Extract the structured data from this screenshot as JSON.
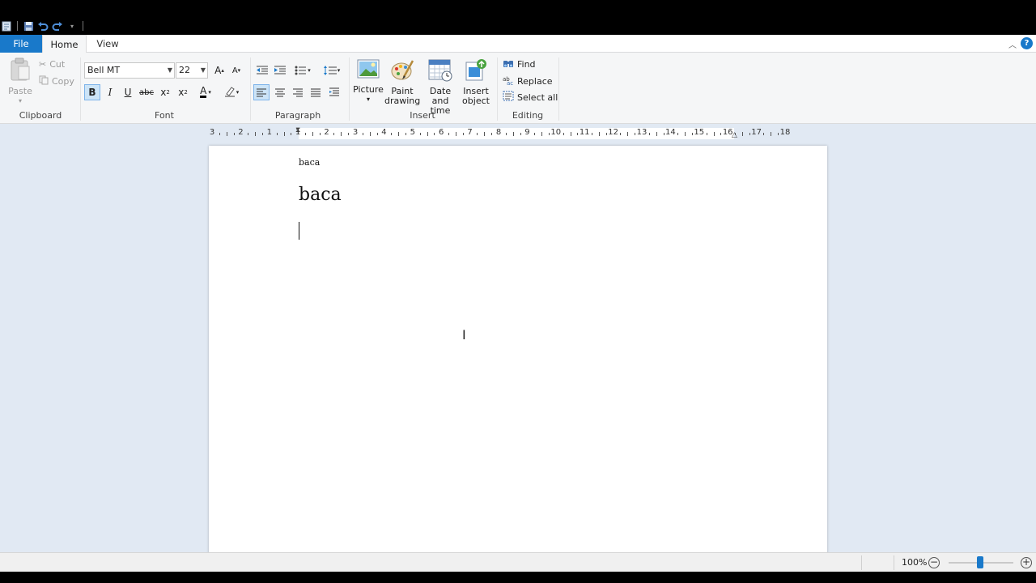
{
  "tabs": {
    "file": "File",
    "home": "Home",
    "view": "View"
  },
  "clipboard": {
    "group": "Clipboard",
    "paste": "Paste",
    "cut": "Cut",
    "copy": "Copy"
  },
  "font": {
    "group": "Font",
    "name": "Bell MT",
    "size": "22"
  },
  "paragraph": {
    "group": "Paragraph"
  },
  "insert": {
    "group": "Insert",
    "picture": "Picture",
    "paint_line1": "Paint",
    "paint_line2": "drawing",
    "date_line1": "Date and",
    "date_line2": "time",
    "object_line1": "Insert",
    "object_line2": "object"
  },
  "editing": {
    "group": "Editing",
    "find": "Find",
    "replace": "Replace",
    "select_all": "Select all"
  },
  "ruler": {
    "numbers": [
      "3",
      "2",
      "1",
      "1",
      "2",
      "3",
      "4",
      "5",
      "6",
      "7",
      "8",
      "9",
      "10",
      "11",
      "12",
      "13",
      "14",
      "15",
      "16",
      "17",
      "18"
    ]
  },
  "document": {
    "line1": "baca",
    "line2": "baca"
  },
  "status": {
    "zoom": "100%"
  },
  "colors": {
    "accent": "#1979ca",
    "ribbon_bg": "#f5f6f7",
    "doc_bg": "#e1e9f3"
  }
}
